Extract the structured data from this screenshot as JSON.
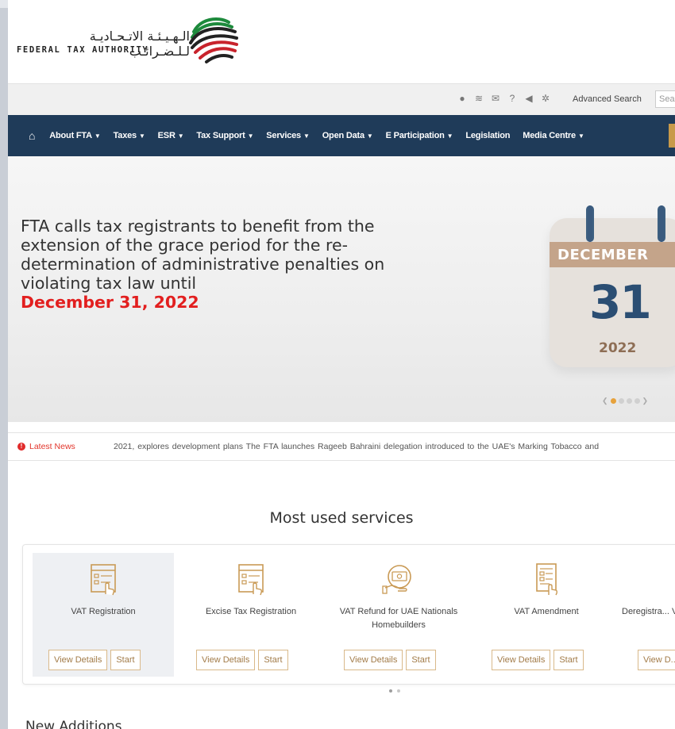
{
  "header": {
    "logo_ar": "الـهـيـئـة الاتـحـاديـة لـلـضـرائـب",
    "logo_en": "FEDERAL TAX AUTHORITY"
  },
  "utility": {
    "icons": [
      "info-icon",
      "wifi-icon",
      "email-icon",
      "help-icon",
      "speaker-icon",
      "gear-icon"
    ],
    "advanced_search": "Advanced Search",
    "search_placeholder": "Sea"
  },
  "nav": {
    "items": [
      {
        "label": "About FTA",
        "chevron": true
      },
      {
        "label": "Taxes",
        "chevron": true
      },
      {
        "label": "ESR",
        "chevron": true
      },
      {
        "label": "Tax Support",
        "chevron": true
      },
      {
        "label": "Services",
        "chevron": true
      },
      {
        "label": "Open Data",
        "chevron": true
      },
      {
        "label": "E Participation",
        "chevron": true
      },
      {
        "label": "Legislation",
        "chevron": false
      },
      {
        "label": "Media Centre",
        "chevron": true
      }
    ]
  },
  "hero": {
    "headline": "FTA calls tax registrants to benefit from the extension of the grace period for the re-determination of administrative penalties on violating tax law until",
    "highlight": "December 31, 2022",
    "calendar_month": "DECEMBER",
    "calendar_day": "31",
    "calendar_year": "2022",
    "accent_color": "#e21f1f"
  },
  "news": {
    "label": "Latest News",
    "ticker": "2021, explores development plans   The FTA launches Rageeb   Bahraini delegation introduced to the UAE's Marking Tobacco and"
  },
  "services": {
    "title": "Most used services",
    "items": [
      {
        "label": "VAT Registration",
        "details": "View Details",
        "start": "Start",
        "icon": "registration-form-icon"
      },
      {
        "label": "Excise Tax Registration",
        "details": "View Details",
        "start": "Start",
        "icon": "registration-form-icon"
      },
      {
        "label": "VAT Refund for UAE Nationals Homebuilders",
        "details": "View Details",
        "start": "Start",
        "icon": "refund-icon"
      },
      {
        "label": "VAT Amendment",
        "details": "View Details",
        "start": "Start",
        "icon": "document-edit-icon"
      },
      {
        "label": "Deregistra... VAT Gro...",
        "details": "View D...",
        "start": "",
        "icon": "deregister-icon"
      }
    ]
  },
  "new_additions": {
    "title": "New Additions"
  }
}
